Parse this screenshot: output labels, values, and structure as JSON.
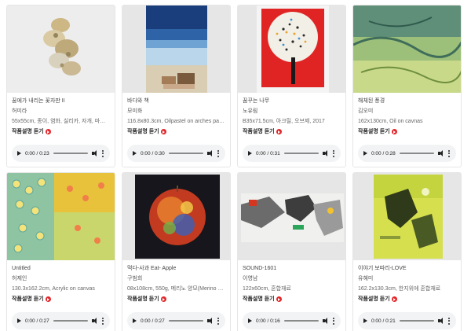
{
  "artworks": [
    {
      "title": "꿈에가 내리는 꽃자판 II",
      "artist": "허미라",
      "spec": "55x55cm, 종이, 염화, 실리카, 자개, 마그네시아...",
      "listen_label": "작품설명 듣기",
      "audio_time": "0:00 / 0:23",
      "thumb_bg": "#ededed"
    },
    {
      "title": "바다와 책",
      "artist": "모미화",
      "spec": "116.8x80.3cm, Oilpastel on arches paper, ...",
      "listen_label": "작품설명 듣기",
      "audio_time": "0:00 / 0:30",
      "thumb_bg": "#1d3f7a"
    },
    {
      "title": "꿈꾸는 나무",
      "artist": "노유림",
      "spec": "B35x71.5cm, 아크릴, 오브제, 2017",
      "listen_label": "작품설명 듣기",
      "audio_time": "0:00 / 0:31",
      "thumb_bg": "#f2f2f2"
    },
    {
      "title": "해체된 풍경",
      "artist": "김오미",
      "spec": "162x130cm, Oil on cavnas",
      "listen_label": "작품설명 듣기",
      "audio_time": "0:00 / 0:28",
      "thumb_bg": "#7ea86b"
    },
    {
      "title": "Untitled",
      "artist": "허제인",
      "spec": "130.3x162.2cm, Acrylic on canvas",
      "listen_label": "작품설명 듣기",
      "audio_time": "0:00 / 0:27",
      "thumb_bg": "#e8c23a"
    },
    {
      "title": "먹다-사과 Eat- Apple",
      "artist": "구범희",
      "spec": "08x108cm, 550g, 메리노 양모(Merino Wool),...",
      "listen_label": "작품설명 듣기",
      "audio_time": "0:00 / 0:27",
      "thumb_bg": "#16161c"
    },
    {
      "title": "SOUND-1601",
      "artist": "이영남",
      "spec": "122x60cm, 혼합재료",
      "listen_label": "작품설명 듣기",
      "audio_time": "0:00 / 0:16",
      "thumb_bg": "#e6e6e6"
    },
    {
      "title": "이야기 보따리-LOVE",
      "artist": "유혜미",
      "spec": "162.2x130.3cm, 한지위에 혼합재료",
      "listen_label": "작품설명 듣기",
      "audio_time": "0:00 / 0:21",
      "thumb_bg": "#e6e6e6"
    }
  ],
  "icons": {
    "listen": "play-circle-icon",
    "play": "play-icon",
    "volume": "volume-icon",
    "more": "more-vertical-icon"
  },
  "colors": {
    "accent": "#e3262a",
    "player_bg": "#f1f3f4"
  }
}
